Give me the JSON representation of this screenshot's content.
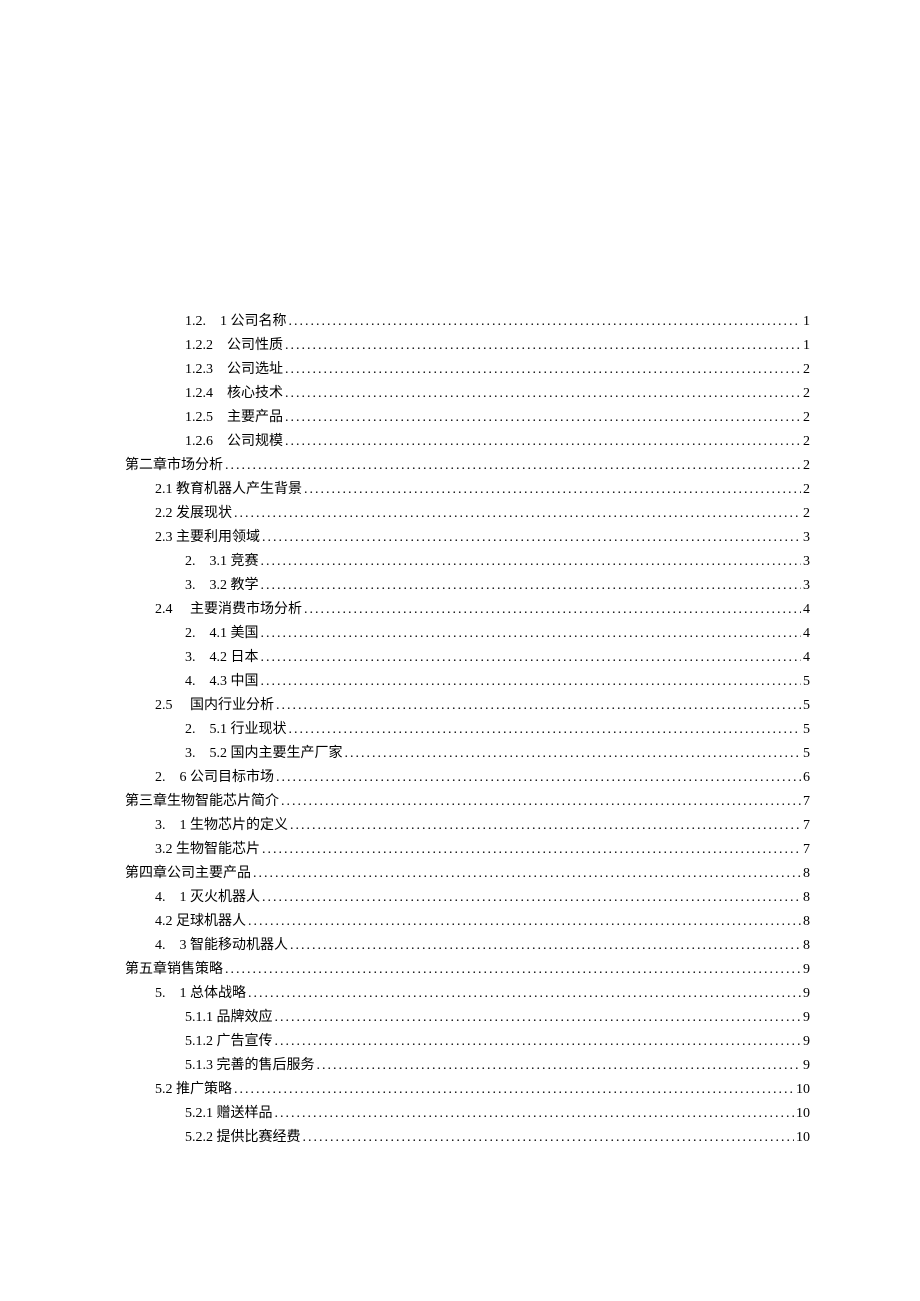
{
  "toc": [
    {
      "indent": 2,
      "label": "1.2.　1 公司名称",
      "page": "1"
    },
    {
      "indent": 2,
      "label": "1.2.2　公司性质",
      "page": "1"
    },
    {
      "indent": 2,
      "label": "1.2.3　公司选址",
      "page": "2"
    },
    {
      "indent": 2,
      "label": "1.2.4　核心技术",
      "page": "2"
    },
    {
      "indent": 2,
      "label": "1.2.5　主要产品",
      "page": "2"
    },
    {
      "indent": 2,
      "label": "1.2.6　公司规模",
      "page": "2"
    },
    {
      "indent": 0,
      "label": "第二章市场分析",
      "page": "2"
    },
    {
      "indent": 1,
      "label": "2.1 教育机器人产生背景",
      "page": "2"
    },
    {
      "indent": 1,
      "label": "2.2 发展现状",
      "page": "2"
    },
    {
      "indent": 1,
      "label": "2.3 主要利用领域",
      "page": "3"
    },
    {
      "indent": 2,
      "label": "2.　3.1 竞赛",
      "page": "3"
    },
    {
      "indent": 2,
      "label": "3.　3.2 教学",
      "page": "3"
    },
    {
      "indent": 1,
      "label": "2.4　 主要消费市场分析",
      "page": "4"
    },
    {
      "indent": 2,
      "label": "2.　4.1 美国",
      "page": "4"
    },
    {
      "indent": 2,
      "label": "3.　4.2 日本",
      "page": "4"
    },
    {
      "indent": 2,
      "label": "4.　4.3 中国",
      "page": "5"
    },
    {
      "indent": 1,
      "label": "2.5　 国内行业分析",
      "page": "5"
    },
    {
      "indent": 2,
      "label": "2.　5.1 行业现状",
      "page": "5"
    },
    {
      "indent": 2,
      "label": "3.　5.2 国内主要生产厂家",
      "page": "5"
    },
    {
      "indent": 1,
      "label": "2.　6 公司目标市场",
      "page": "6"
    },
    {
      "indent": 0,
      "label": "第三章生物智能芯片简介",
      "page": "7"
    },
    {
      "indent": 1,
      "label": "3.　1 生物芯片的定义",
      "page": "7"
    },
    {
      "indent": 1,
      "label": "3.2 生物智能芯片",
      "page": "7"
    },
    {
      "indent": 0,
      "label": "第四章公司主要产品",
      "page": "8"
    },
    {
      "indent": 1,
      "label": "4.　1 灭火机器人",
      "page": "8"
    },
    {
      "indent": 1,
      "label": "4.2 足球机器人",
      "page": "8"
    },
    {
      "indent": 1,
      "label": "4.　3 智能移动机器人",
      "page": "8"
    },
    {
      "indent": 0,
      "label": "第五章销售策略",
      "page": "9"
    },
    {
      "indent": 1,
      "label": "5.　1 总体战略",
      "page": "9"
    },
    {
      "indent": 2,
      "label": "5.1.1 品牌效应",
      "page": "9"
    },
    {
      "indent": 2,
      "label": "5.1.2 广告宣传",
      "page": "9"
    },
    {
      "indent": 2,
      "label": "5.1.3 完善的售后服务",
      "page": "9"
    },
    {
      "indent": 1,
      "label": "5.2 推广策略",
      "page": "10"
    },
    {
      "indent": 2,
      "label": "5.2.1 赠送样品",
      "page": "10"
    },
    {
      "indent": 2,
      "label": "5.2.2 提供比赛经费",
      "page": "10"
    }
  ]
}
